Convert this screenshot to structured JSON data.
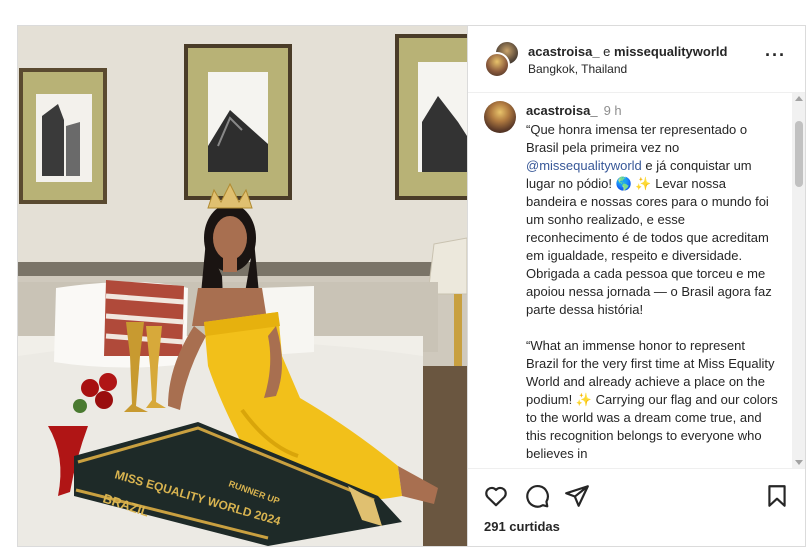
{
  "post": {
    "header": {
      "author": "acastroisa_",
      "connector": " e ",
      "coauthor": "missequalityworld",
      "location": "Bangkok, Thailand",
      "more_icon": "more-horizontal-icon"
    },
    "photo": {
      "description_icon": "photo",
      "sash_text": "MISS EQUALITY WORLD 2024",
      "sash_text_2": "BRAZIL",
      "sash_text_3": "RUNNER UP"
    },
    "caption": {
      "username": "acastroisa_",
      "time": "9 h",
      "pt_before": "“Que honra imensa ter representado o Brasil pela primeira vez no ",
      "mention": "@missequalityworld",
      "pt_after": " e já conquistar um lugar no pódio! 🌎 ✨  Levar nossa bandeira e nossas cores para o mundo foi um sonho realizado, e esse reconhecimento é de todos que acreditam em igualdade, respeito e diversidade. Obrigada a cada pessoa que torceu e me apoiou nessa jornada — o Brasil agora faz parte dessa história!",
      "en_text": "“What an immense honor to represent Brazil for the very first time at Miss Equality World and already achieve a place on the podium! ✨  Carrying our flag and our colors to the world was a dream come true, and this recognition belongs to everyone who believes in"
    },
    "actions": {
      "like_icon": "heart-icon",
      "comment_icon": "comment-icon",
      "share_icon": "send-icon",
      "save_icon": "bookmark-icon",
      "likes": "291 curtidas"
    },
    "colors": {
      "mention": "#385898",
      "text": "#262626",
      "muted": "#8e8e8e",
      "border": "#dbdbdb"
    }
  }
}
